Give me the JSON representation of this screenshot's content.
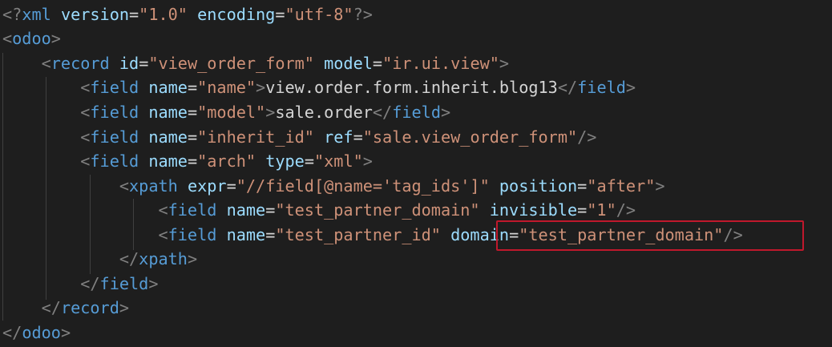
{
  "editor": {
    "language": "xml",
    "theme_colors": {
      "background": "#1e1e1e",
      "punctuation": "#808080",
      "tag": "#569cd6",
      "attribute": "#9cdcfe",
      "string": "#ce9178",
      "text": "#d4d4d4",
      "highlight_border": "#c0182c"
    },
    "highlight_label": "domain=\"test_partner_domain\"",
    "lines": [
      [
        {
          "t": "punct",
          "v": "<?"
        },
        {
          "t": "tag",
          "v": "xml"
        },
        {
          "t": "text",
          "v": " "
        },
        {
          "t": "attr",
          "v": "version"
        },
        {
          "t": "eq",
          "v": "="
        },
        {
          "t": "str",
          "v": "\"1.0\""
        },
        {
          "t": "text",
          "v": " "
        },
        {
          "t": "attr",
          "v": "encoding"
        },
        {
          "t": "eq",
          "v": "="
        },
        {
          "t": "str",
          "v": "\"utf-8\""
        },
        {
          "t": "punct",
          "v": "?>"
        }
      ],
      [
        {
          "t": "punct",
          "v": "<"
        },
        {
          "t": "tag",
          "v": "odoo"
        },
        {
          "t": "punct",
          "v": ">"
        }
      ],
      [
        {
          "t": "text",
          "v": "    "
        },
        {
          "t": "punct",
          "v": "<"
        },
        {
          "t": "tag",
          "v": "record"
        },
        {
          "t": "text",
          "v": " "
        },
        {
          "t": "attr",
          "v": "id"
        },
        {
          "t": "eq",
          "v": "="
        },
        {
          "t": "str",
          "v": "\"view_order_form\""
        },
        {
          "t": "text",
          "v": " "
        },
        {
          "t": "attr",
          "v": "model"
        },
        {
          "t": "eq",
          "v": "="
        },
        {
          "t": "str",
          "v": "\"ir.ui.view\""
        },
        {
          "t": "punct",
          "v": ">"
        }
      ],
      [
        {
          "t": "text",
          "v": "        "
        },
        {
          "t": "punct",
          "v": "<"
        },
        {
          "t": "tag",
          "v": "field"
        },
        {
          "t": "text",
          "v": " "
        },
        {
          "t": "attr",
          "v": "name"
        },
        {
          "t": "eq",
          "v": "="
        },
        {
          "t": "str",
          "v": "\"name\""
        },
        {
          "t": "punct",
          "v": ">"
        },
        {
          "t": "text",
          "v": "view.order.form.inherit.blog13"
        },
        {
          "t": "punct",
          "v": "</"
        },
        {
          "t": "tag",
          "v": "field"
        },
        {
          "t": "punct",
          "v": ">"
        }
      ],
      [
        {
          "t": "text",
          "v": "        "
        },
        {
          "t": "punct",
          "v": "<"
        },
        {
          "t": "tag",
          "v": "field"
        },
        {
          "t": "text",
          "v": " "
        },
        {
          "t": "attr",
          "v": "name"
        },
        {
          "t": "eq",
          "v": "="
        },
        {
          "t": "str",
          "v": "\"model\""
        },
        {
          "t": "punct",
          "v": ">"
        },
        {
          "t": "text",
          "v": "sale.order"
        },
        {
          "t": "punct",
          "v": "</"
        },
        {
          "t": "tag",
          "v": "field"
        },
        {
          "t": "punct",
          "v": ">"
        }
      ],
      [
        {
          "t": "text",
          "v": "        "
        },
        {
          "t": "punct",
          "v": "<"
        },
        {
          "t": "tag",
          "v": "field"
        },
        {
          "t": "text",
          "v": " "
        },
        {
          "t": "attr",
          "v": "name"
        },
        {
          "t": "eq",
          "v": "="
        },
        {
          "t": "str",
          "v": "\"inherit_id\""
        },
        {
          "t": "text",
          "v": " "
        },
        {
          "t": "attr",
          "v": "ref"
        },
        {
          "t": "eq",
          "v": "="
        },
        {
          "t": "str",
          "v": "\"sale.view_order_form\""
        },
        {
          "t": "punct",
          "v": "/>"
        }
      ],
      [
        {
          "t": "text",
          "v": "        "
        },
        {
          "t": "punct",
          "v": "<"
        },
        {
          "t": "tag",
          "v": "field"
        },
        {
          "t": "text",
          "v": " "
        },
        {
          "t": "attr",
          "v": "name"
        },
        {
          "t": "eq",
          "v": "="
        },
        {
          "t": "str",
          "v": "\"arch\""
        },
        {
          "t": "text",
          "v": " "
        },
        {
          "t": "attr",
          "v": "type"
        },
        {
          "t": "eq",
          "v": "="
        },
        {
          "t": "str",
          "v": "\"xml\""
        },
        {
          "t": "punct",
          "v": ">"
        }
      ],
      [
        {
          "t": "text",
          "v": "            "
        },
        {
          "t": "punct",
          "v": "<"
        },
        {
          "t": "tag",
          "v": "xpath"
        },
        {
          "t": "text",
          "v": " "
        },
        {
          "t": "attr",
          "v": "expr"
        },
        {
          "t": "eq",
          "v": "="
        },
        {
          "t": "str",
          "v": "\"//field[@name='tag_ids']\""
        },
        {
          "t": "text",
          "v": " "
        },
        {
          "t": "attr",
          "v": "position"
        },
        {
          "t": "eq",
          "v": "="
        },
        {
          "t": "str",
          "v": "\"after\""
        },
        {
          "t": "punct",
          "v": ">"
        }
      ],
      [
        {
          "t": "text",
          "v": "                "
        },
        {
          "t": "punct",
          "v": "<"
        },
        {
          "t": "tag",
          "v": "field"
        },
        {
          "t": "text",
          "v": " "
        },
        {
          "t": "attr",
          "v": "name"
        },
        {
          "t": "eq",
          "v": "="
        },
        {
          "t": "str",
          "v": "\"test_partner_domain\""
        },
        {
          "t": "text",
          "v": " "
        },
        {
          "t": "attr",
          "v": "invisible"
        },
        {
          "t": "eq",
          "v": "="
        },
        {
          "t": "str",
          "v": "\"1\""
        },
        {
          "t": "punct",
          "v": "/>"
        }
      ],
      [
        {
          "t": "text",
          "v": "                "
        },
        {
          "t": "punct",
          "v": "<"
        },
        {
          "t": "tag",
          "v": "field"
        },
        {
          "t": "text",
          "v": " "
        },
        {
          "t": "attr",
          "v": "name"
        },
        {
          "t": "eq",
          "v": "="
        },
        {
          "t": "str",
          "v": "\"test_partner_id\""
        },
        {
          "t": "text",
          "v": " "
        },
        {
          "t": "attr",
          "v": "domain"
        },
        {
          "t": "eq",
          "v": "="
        },
        {
          "t": "str",
          "v": "\"test_partner_domain\""
        },
        {
          "t": "punct",
          "v": "/>"
        }
      ],
      [
        {
          "t": "text",
          "v": "            "
        },
        {
          "t": "punct",
          "v": "</"
        },
        {
          "t": "tag",
          "v": "xpath"
        },
        {
          "t": "punct",
          "v": ">"
        }
      ],
      [
        {
          "t": "text",
          "v": "        "
        },
        {
          "t": "punct",
          "v": "</"
        },
        {
          "t": "tag",
          "v": "field"
        },
        {
          "t": "punct",
          "v": ">"
        }
      ],
      [
        {
          "t": "text",
          "v": "    "
        },
        {
          "t": "punct",
          "v": "</"
        },
        {
          "t": "tag",
          "v": "record"
        },
        {
          "t": "punct",
          "v": ">"
        }
      ],
      [
        {
          "t": "punct",
          "v": "</"
        },
        {
          "t": "tag",
          "v": "odoo"
        },
        {
          "t": "punct",
          "v": ">"
        }
      ]
    ]
  }
}
